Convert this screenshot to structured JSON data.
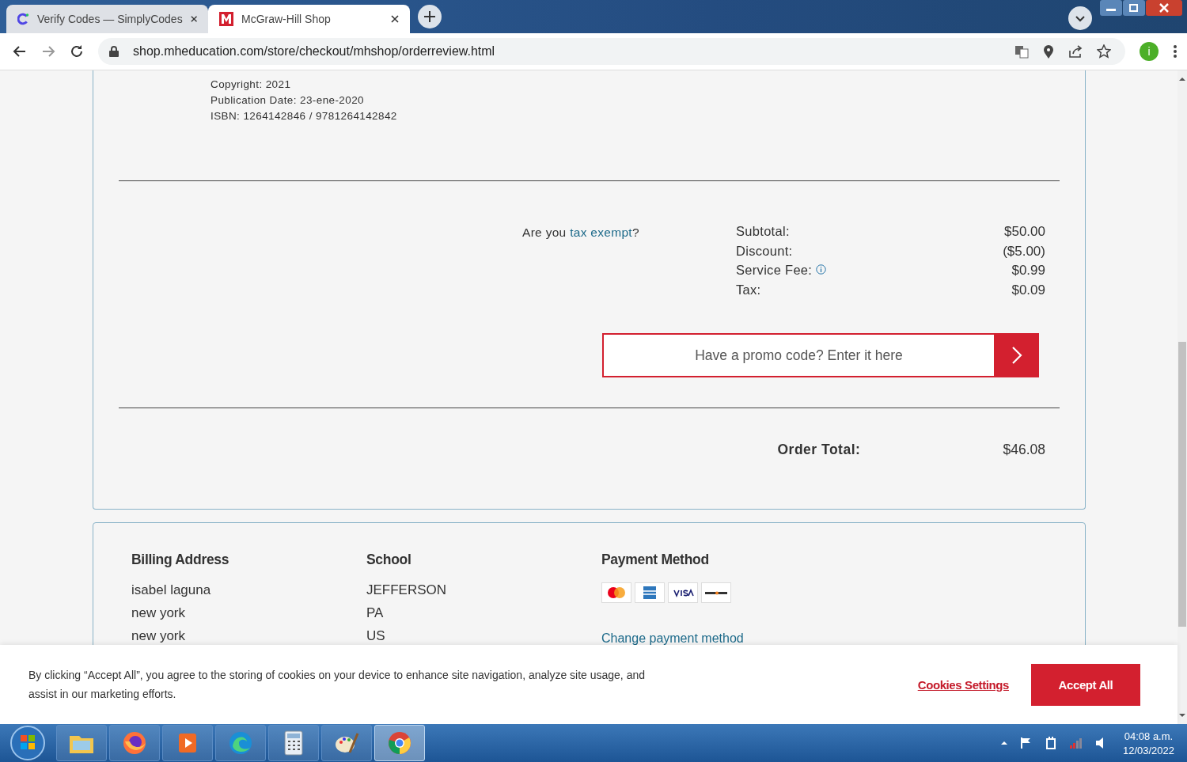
{
  "browser": {
    "tabs": [
      {
        "title": "Verify Codes — SimplyCodes",
        "selected": false,
        "kind": "simplycodes"
      },
      {
        "title": "McGraw-Hill Shop",
        "selected": true,
        "kind": "mh"
      }
    ],
    "url": "shop.mheducation.com/store/checkout/mhshop/orderreview.html",
    "profile_initial": "i"
  },
  "product": {
    "lines": [
      "Copyright: 2021",
      "Publication Date: 23-ene-2020",
      "ISBN: 1264142846 / 9781264142842"
    ]
  },
  "totals": {
    "tax_exempt": {
      "prefix": "Are you",
      "link": "tax exempt",
      "suffix": "?"
    },
    "rows": [
      {
        "label": "Subtotal:",
        "value": "$50.00",
        "info": false
      },
      {
        "label": "Discount:",
        "value": "($5.00)",
        "info": false
      },
      {
        "label": "Service Fee:",
        "value": "$0.99",
        "info": true
      },
      {
        "label": "Tax:",
        "value": "$0.09",
        "info": false
      }
    ],
    "promo": {
      "placeholder": "Have a promo code? Enter it here"
    },
    "order_total": {
      "label": "Order Total:",
      "value": "$46.08"
    }
  },
  "summary": {
    "columns": [
      {
        "heading": "Billing Address",
        "lines": [
          "isabel laguna",
          "new york",
          "new york"
        ]
      },
      {
        "heading": "School",
        "lines": [
          "JEFFERSON",
          "PA",
          "US"
        ]
      }
    ],
    "payment": {
      "heading": "Payment Method",
      "cards": [
        {
          "kind": "mastercard"
        },
        {
          "kind": "amex"
        },
        {
          "kind": "visa"
        },
        {
          "kind": "discover"
        }
      ],
      "link": "Change payment method"
    }
  },
  "cookie_banner": {
    "text": "By clicking “Accept All”, you agree to the storing of cookies on your device to enhance site navigation, analyze site usage, and assist in our marketing efforts.",
    "settings": "Cookies Settings",
    "accept": "Accept All"
  },
  "taskbar": {
    "apps": [
      {
        "kind": "explorer",
        "selected": false
      },
      {
        "kind": "firefox",
        "selected": false
      },
      {
        "kind": "media",
        "selected": false
      },
      {
        "kind": "edge",
        "selected": false
      },
      {
        "kind": "calculator",
        "selected": false
      },
      {
        "kind": "paint",
        "selected": false
      },
      {
        "kind": "chrome",
        "selected": true
      }
    ],
    "time": "04:08 a.m.",
    "date": "12/03/2022"
  }
}
